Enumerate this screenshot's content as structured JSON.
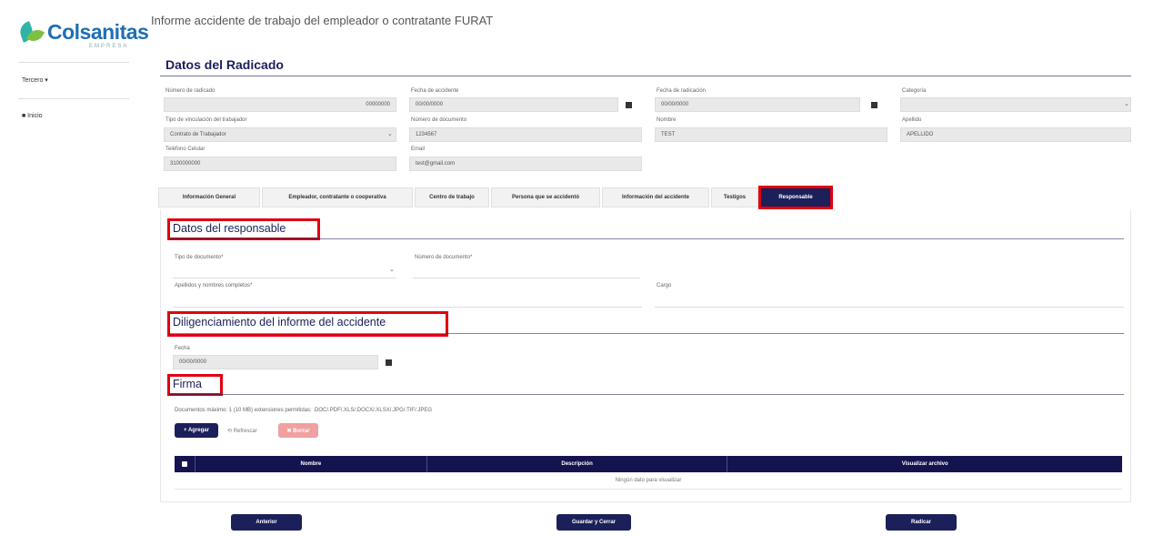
{
  "app": {
    "logo_text": "Colsanitas",
    "logo_sub": "EMPRESA",
    "page_title": "Informe accidente de trabajo del empleador o contratante FURAT"
  },
  "sidebar": {
    "items": [
      {
        "label": "Tercero ▾",
        "icon": "dropdown-icon"
      },
      {
        "label": "■ Inicio",
        "icon": "home-icon"
      }
    ]
  },
  "radicado": {
    "title": "Datos del Radicado",
    "fields": {
      "numero_radicado": {
        "label": "Número de radicado",
        "value": "00000000"
      },
      "fecha_accidente": {
        "label": "Fecha de accidente",
        "value": "00/00/0000"
      },
      "fecha_radicacion": {
        "label": "Fecha de radicación",
        "value": "00/00/0000"
      },
      "categoria": {
        "label": "Categoría",
        "value": ""
      },
      "tipo_empleo": {
        "label": "Tipo de vinculación del trabajador",
        "value": "Contrato de Trabajador"
      },
      "numero_documento": {
        "label": "Número de documento",
        "value": "1234567"
      },
      "nombre": {
        "label": "Nombre",
        "value": "TEST"
      },
      "apellido": {
        "label": "Apellido",
        "value": "APELLIDO"
      },
      "telefono": {
        "label": "Teléfono Celular",
        "value": "3100000000"
      },
      "email": {
        "label": "Email",
        "value": "test@gmail.com"
      }
    }
  },
  "tabs": [
    {
      "label": "Información General",
      "active": false
    },
    {
      "label": "Empleador, contratante o cooperativa",
      "active": false
    },
    {
      "label": "Centro de trabajo",
      "active": false
    },
    {
      "label": "Persona que se accidentó",
      "active": false
    },
    {
      "label": "Información del accidente",
      "active": false
    },
    {
      "label": "Testigos",
      "active": false
    },
    {
      "label": "Responsable",
      "active": true
    }
  ],
  "responsable": {
    "title": "Datos del responsable",
    "tipo_documento_label": "Tipo de documento*",
    "numero_documento_label": "Número de documento*",
    "nombres_label": "Apellidos y nombres completos*",
    "cargo_label": "Cargo"
  },
  "diligenciamiento": {
    "title": "Diligenciamiento del informe del accidente",
    "fecha_label": "Fecha",
    "fecha_value": "00/00/0000"
  },
  "firma": {
    "title": "Firma",
    "help_text": "Documentos máximo: 1 (10 MB) extensiones permitidas: .DOC/.PDF/.XLS/.DOCX/.XLSX/.JPG/.TIF/.JPEG",
    "upload_label": "+ Agregar",
    "refresh_label": "⟲ Refrescar",
    "delete_label": "✖ Borrar",
    "table": {
      "columns": [
        "",
        "Nombre",
        "Descripción",
        "Visualizar archivo"
      ],
      "empty_text": "Ningún dato para visualizar"
    }
  },
  "footer": {
    "prev_label": "Anterior",
    "save_label": "Guardar y Cerrar",
    "next_label": "Radicar"
  },
  "colors": {
    "primary": "#1b1f5a",
    "highlight": "#e0000f",
    "logo_blue": "#1f6fb5",
    "logo_green": "#7cc242"
  }
}
